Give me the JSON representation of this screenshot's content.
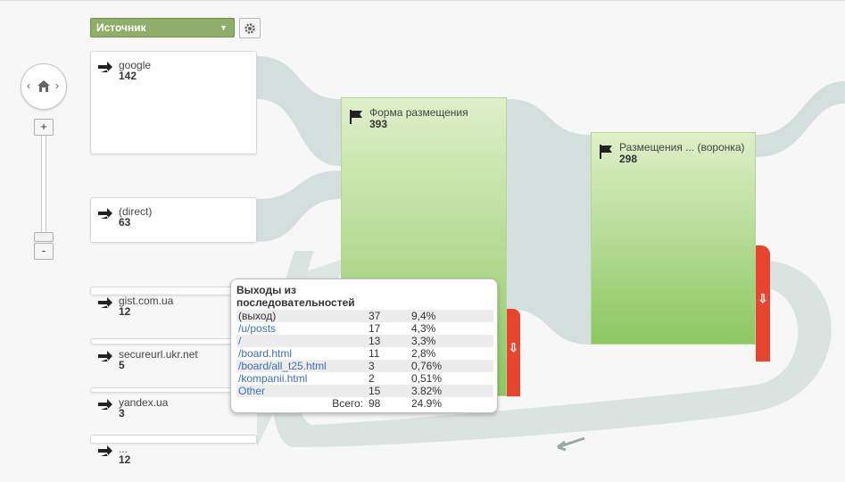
{
  "dimension_selector": {
    "label": "Источник"
  },
  "sources": [
    {
      "name": "google",
      "count": "142"
    },
    {
      "name": "(direct)",
      "count": "63"
    },
    {
      "name": "gist.com.ua",
      "count": "12"
    },
    {
      "name": "secureurl.ukr.net",
      "count": "5"
    },
    {
      "name": "yandex.ua",
      "count": "3"
    },
    {
      "name": "...",
      "count": "12"
    }
  ],
  "pages": [
    {
      "name": "Форма размещения",
      "count": "393"
    },
    {
      "name": "Размещения ... (воронка)",
      "count": "298"
    }
  ],
  "tooltip": {
    "title": "Выходы из последовательностей",
    "rows": [
      {
        "page": "(выход)",
        "count": "37",
        "percent": "9,4%",
        "link": false
      },
      {
        "page": "/u/posts",
        "count": "17",
        "percent": "4,3%",
        "link": true
      },
      {
        "page": "/",
        "count": "13",
        "percent": "3,3%",
        "link": true
      },
      {
        "page": "/board.html",
        "count": "11",
        "percent": "2,8%",
        "link": true
      },
      {
        "page": "/board/all_t25.html",
        "count": "3",
        "percent": "0,76%",
        "link": true
      },
      {
        "page": "/kompanii.html",
        "count": "2",
        "percent": "0,51%",
        "link": true
      },
      {
        "page": "Other",
        "count": "15",
        "percent": "3.82%",
        "link": true
      }
    ],
    "total_label": "Всего:",
    "total_count": "98",
    "total_percent": "24.9%"
  },
  "colors": {
    "dropdown": "#8fae6a",
    "node_gradient_top": "#def0c9",
    "node_gradient_bottom": "#8cc760",
    "drop_off": "#e8452f",
    "flow": "#d3dfdc",
    "link": "#3b6fb6"
  }
}
